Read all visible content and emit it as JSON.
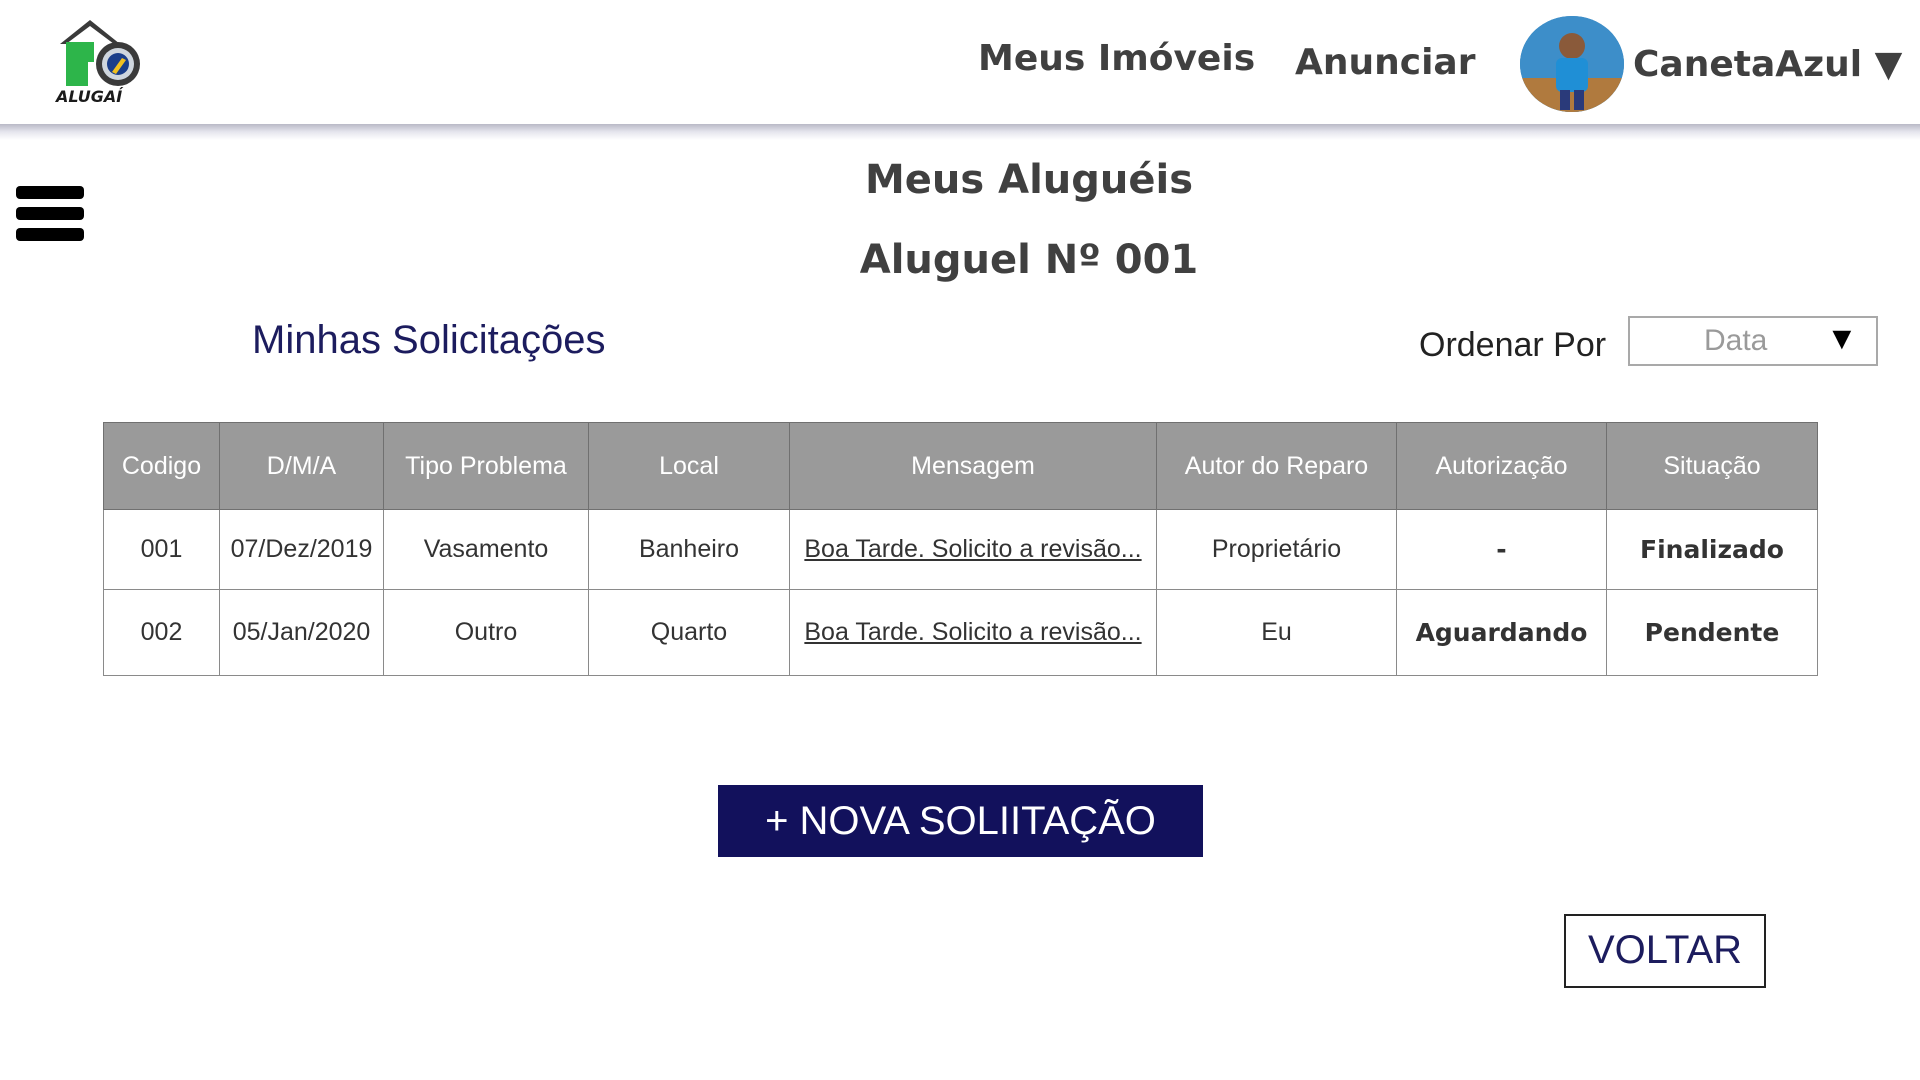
{
  "header": {
    "logo_text": "ALUGAÍ",
    "nav": {
      "meus_imoveis": "Meus Imóveis",
      "anunciar": "Anunciar"
    },
    "user": {
      "name": "CanetaAzul",
      "dropdown_glyph": "▼"
    }
  },
  "menu": {
    "icon": "hamburger-menu-icon"
  },
  "page": {
    "title": "Meus Aluguéis",
    "subtitle": "Aluguel Nº 001"
  },
  "section": {
    "title": "Minhas Solicitações"
  },
  "sort": {
    "label": "Ordenar Por",
    "selected": "Data",
    "arrow": "▼"
  },
  "table": {
    "headers": [
      "Codigo",
      "D/M/A",
      "Tipo Problema",
      "Local",
      "Mensagem",
      "Autor do Reparo",
      "Autorização",
      "Situação"
    ],
    "rows": [
      {
        "codigo": "001",
        "data": "07/Dez/2019",
        "tipo": "Vasamento",
        "local": "Banheiro",
        "mensagem": "Boa Tarde. Solicito a revisão...",
        "autor": "Proprietário",
        "autorizacao": "-",
        "situacao": "Finalizado"
      },
      {
        "codigo": "002",
        "data": "05/Jan/2020",
        "tipo": "Outro",
        "local": "Quarto",
        "mensagem": "Boa Tarde. Solicito a revisão...",
        "autor": "Eu",
        "autorizacao": "Aguardando",
        "situacao": "Pendente"
      }
    ]
  },
  "buttons": {
    "nova": "+ NOVA SOLIITAÇÃO",
    "voltar": "VOLTAR"
  },
  "colors": {
    "primary": "#12115c",
    "status_ok": "#1a7a1a",
    "status_pending": "#e0181c",
    "header_gray": "#9a9a9a"
  }
}
